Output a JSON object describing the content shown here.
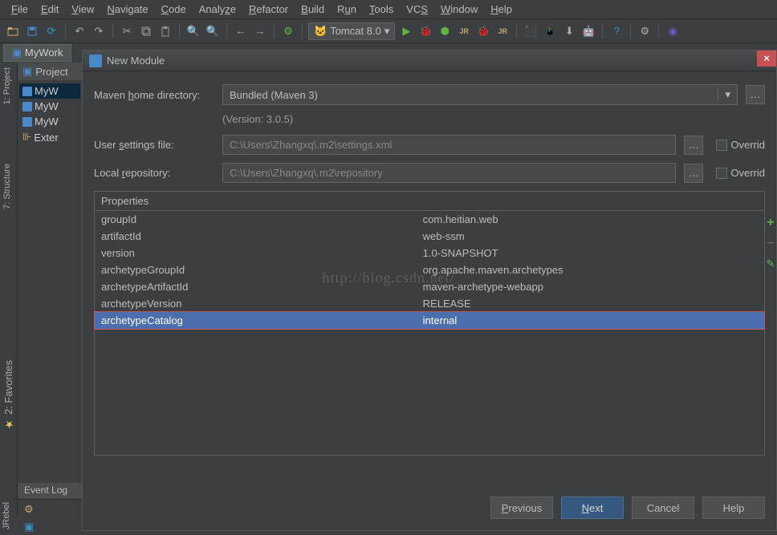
{
  "menu": {
    "file": "File",
    "edit": "Edit",
    "view": "View",
    "navigate": "Navigate",
    "code": "Code",
    "analyze": "Analyze",
    "refactor": "Refactor",
    "build": "Build",
    "run": "Run",
    "tools": "Tools",
    "vcs": "VCS",
    "window": "Window",
    "help": "Help"
  },
  "runConfig": {
    "label": "Tomcat 8.0",
    "dropdown": "▾"
  },
  "editorTab": "MyWork",
  "projectTool": {
    "header": "Project",
    "items": [
      "MyW",
      "MyW",
      "MyW",
      "Exter"
    ]
  },
  "sidebars": {
    "project": "1: Project",
    "structure": "7: Structure",
    "favorites": "2: Favorites",
    "jrebel": "JRebel"
  },
  "eventLog": "Event Log",
  "dialog": {
    "title": "New Module",
    "mavenHomeLabel": "Maven home directory:",
    "mavenHomeValue": "Bundled (Maven 3)",
    "versionText": "(Version: 3.0.5)",
    "userSettingsLabel": "User settings file:",
    "userSettingsValue": "C:\\Users\\Zhangxq\\.m2\\settings.xml",
    "localRepoLabel": "Local repository:",
    "localRepoValue": "C:\\Users\\Zhangxq\\.m2\\repository",
    "overrideLabel": "Overrid",
    "propertiesHeader": "Properties",
    "properties": [
      {
        "k": "groupId",
        "v": "com.heitian.web"
      },
      {
        "k": "artifactId",
        "v": "web-ssm"
      },
      {
        "k": "version",
        "v": "1.0-SNAPSHOT"
      },
      {
        "k": "archetypeGroupId",
        "v": "org.apache.maven.archetypes"
      },
      {
        "k": "archetypeArtifactId",
        "v": "maven-archetype-webapp"
      },
      {
        "k": "archetypeVersion",
        "v": "RELEASE"
      },
      {
        "k": "archetypeCatalog",
        "v": "internal"
      }
    ],
    "buttons": {
      "previous": "Previous",
      "next": "Next",
      "cancel": "Cancel",
      "help": "Help"
    }
  },
  "watermark": "http://blog.csdn.net/"
}
